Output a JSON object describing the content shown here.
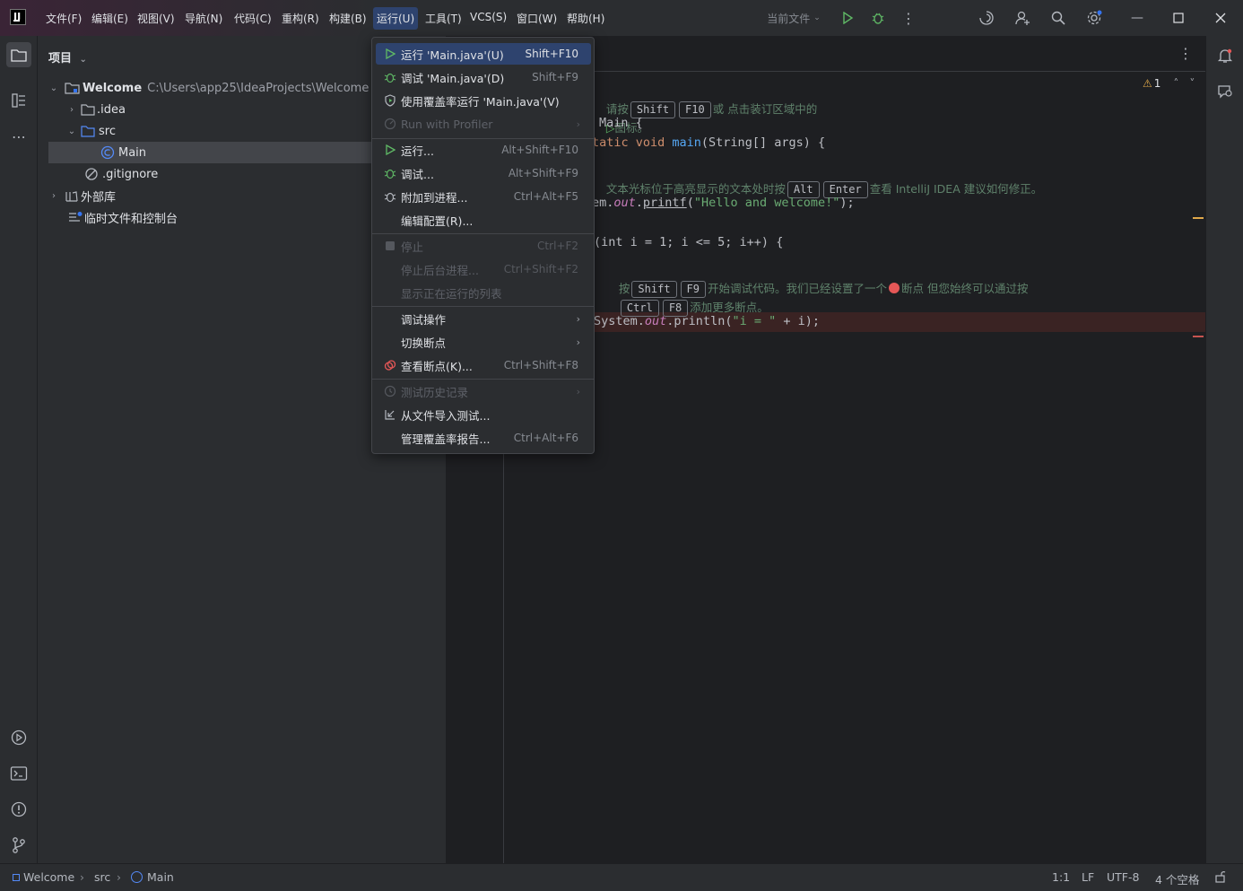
{
  "menubar": {
    "items": [
      "文件(F)",
      "编辑(E)",
      "视图(V)",
      "导航(N)",
      "代码(C)",
      "重构(R)",
      "构建(B)",
      "运行(U)",
      "工具(T)",
      "VCS(S)",
      "窗口(W)",
      "帮助(H)"
    ],
    "active_index": 7,
    "run_config": "当前文件"
  },
  "project": {
    "title": "项目",
    "root_name": "Welcome",
    "root_path": "C:\\Users\\app25\\IdeaProjects\\Welcome",
    "items": [
      ".idea",
      "src",
      "Main",
      ".gitignore",
      "外部库",
      "临时文件和控制台"
    ]
  },
  "run_menu": {
    "items": [
      {
        "label": "运行 'Main.java'(U)",
        "shortcut": "Shift+F10"
      },
      {
        "label": "调试 'Main.java'(D)",
        "shortcut": "Shift+F9"
      },
      {
        "label": "使用覆盖率运行 'Main.java'(V)",
        "shortcut": ""
      },
      {
        "label": "Run with Profiler",
        "shortcut": ""
      },
      {
        "label": "运行...",
        "shortcut": "Alt+Shift+F10"
      },
      {
        "label": "调试...",
        "shortcut": "Alt+Shift+F9"
      },
      {
        "label": "附加到进程...",
        "shortcut": "Ctrl+Alt+F5"
      },
      {
        "label": "编辑配置(R)...",
        "shortcut": ""
      },
      {
        "label": "停止",
        "shortcut": "Ctrl+F2"
      },
      {
        "label": "停止后台进程...",
        "shortcut": "Ctrl+Shift+F2"
      },
      {
        "label": "显示正在运行的列表",
        "shortcut": ""
      },
      {
        "label": "调试操作",
        "shortcut": ""
      },
      {
        "label": "切换断点",
        "shortcut": ""
      },
      {
        "label": "查看断点(K)...",
        "shortcut": "Ctrl+Shift+F8"
      },
      {
        "label": "测试历史记录",
        "shortcut": ""
      },
      {
        "label": "从文件导入测试...",
        "shortcut": ""
      },
      {
        "label": "管理覆盖率报告...",
        "shortcut": "Ctrl+Alt+F6"
      }
    ]
  },
  "editor": {
    "warnings": "1",
    "hint1_pre": "请按",
    "hint1_post": "或 点击装订区域中的",
    "hint1_end": "图标。",
    "line_class": "Main {",
    "line_main_a": "tatic void ",
    "line_main_fn": "main",
    "line_main_b": "(String[] args) {",
    "hint2_pre": "文本光标位于高亮显示的文本处时按",
    "hint2_post": "查看 IntelliJ IDEA 建议如何修正。",
    "line_printf_a": "em.",
    "line_printf_out": "out",
    "line_printf_b": ".",
    "line_printf_fn": "printf",
    "line_printf_c": "(",
    "line_printf_str": "\"Hello and welcome!\"",
    "line_printf_d": ");",
    "line_for": "(int i = 1; i <= 5; i++) {",
    "hint3_pre": "按",
    "hint3_mid": "开始调试代码。我们已经设置了一个",
    "hint3_post": "断点 但您始终可以通过按",
    "hint4_post": "添加更多断点。",
    "line_println_a": "System.",
    "line_println_out": "out",
    "line_println_b": ".println(",
    "line_println_str": "\"i = \"",
    "line_println_c": " + i);",
    "keys": [
      "Shift",
      "F10",
      "Alt",
      "Enter",
      "Shift",
      "F9",
      "Ctrl",
      "F8"
    ]
  },
  "statusbar": {
    "breadcrumb": [
      "Welcome",
      "src",
      "Main"
    ],
    "position": "1:1",
    "line_sep": "LF",
    "encoding": "UTF-8",
    "indent": "4 个空格"
  },
  "colors": {
    "accent": "#2e436e",
    "run_green": "#5fb865",
    "breakpoint_red": "#e55757"
  }
}
